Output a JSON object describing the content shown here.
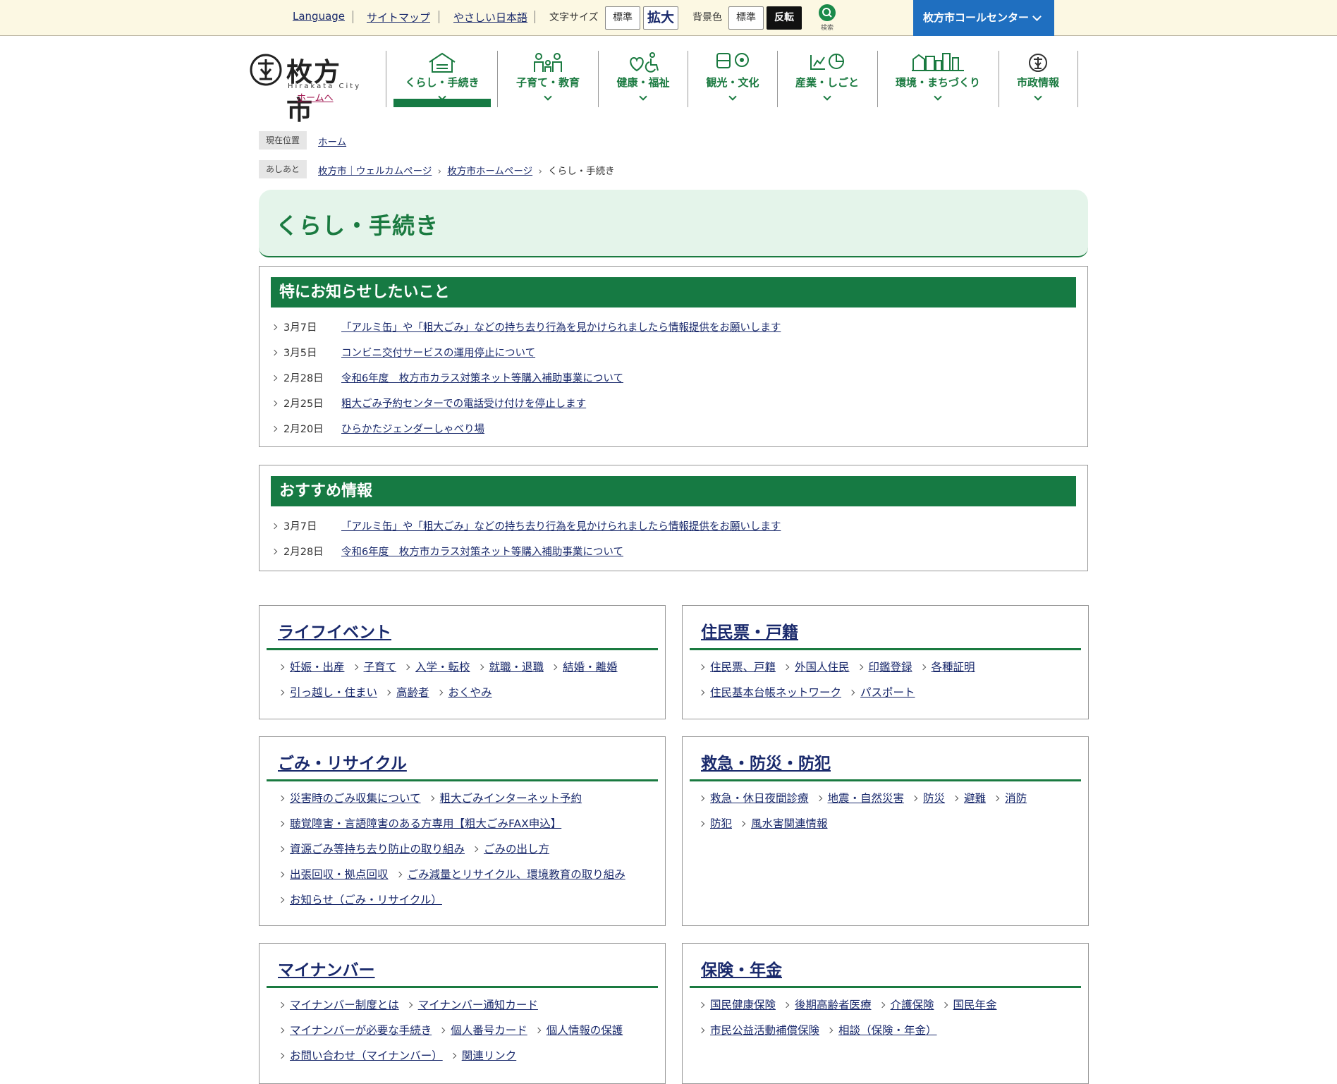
{
  "topbar": {
    "language": "Language",
    "sitemap": "サイトマップ",
    "easy_japanese": "やさしい日本語",
    "font_size_label": "文字サイズ",
    "font_standard": "標準",
    "font_large": "拡大",
    "bg_label": "背景色",
    "bg_standard": "標準",
    "bg_invert": "反転",
    "search_label": "検索",
    "call_center": "枚方市コールセンター"
  },
  "logo": {
    "name": "枚方市",
    "romaji": "Hirakata City",
    "home_link": "ホームへ"
  },
  "nav": [
    {
      "label": "くらし・手続き",
      "icon": "house-icon",
      "active": true
    },
    {
      "label": "子育て・教育",
      "icon": "family-icon"
    },
    {
      "label": "健康・福祉",
      "icon": "health-wheelchair-icon"
    },
    {
      "label": "観光・文化",
      "icon": "bus-flower-icon"
    },
    {
      "label": "産業・しごと",
      "icon": "chart-icon"
    },
    {
      "label": "環境・まちづくり",
      "icon": "city-icon"
    },
    {
      "label": "市政情報",
      "icon": "city-emblem-icon"
    }
  ],
  "breadcrumb": {
    "current_badge": "現在位置",
    "home": "ホーム",
    "trail_badge": "あしあと",
    "trail": [
      "枚方市｜ウェルカムページ",
      "枚方市ホームページ",
      "くらし・手続き"
    ]
  },
  "page_title": "くらし・手続き",
  "notices": {
    "title": "特にお知らせしたいこと",
    "items": [
      {
        "date": "3月7日",
        "text": "「アルミ缶」や「粗大ごみ」などの持ち去り行為を見かけられましたら情報提供をお願いします"
      },
      {
        "date": "3月5日",
        "text": "コンビニ交付サービスの運用停止について"
      },
      {
        "date": "2月28日",
        "text": "令和6年度　枚方市カラス対策ネット等購入補助事業について"
      },
      {
        "date": "2月25日",
        "text": "粗大ごみ予約センターでの電話受け付けを停止します"
      },
      {
        "date": "2月20日",
        "text": "ひらかたジェンダーしゃべり場"
      }
    ]
  },
  "recommended": {
    "title": "おすすめ情報",
    "items": [
      {
        "date": "3月7日",
        "text": "「アルミ缶」や「粗大ごみ」などの持ち去り行為を見かけられましたら情報提供をお願いします"
      },
      {
        "date": "2月28日",
        "text": "令和6年度　枚方市カラス対策ネット等購入補助事業について"
      }
    ]
  },
  "categories": [
    {
      "title": "ライフイベント",
      "rows": [
        [
          "妊娠・出産",
          "子育て",
          "入学・転校",
          "就職・退職",
          "結婚・離婚"
        ],
        [
          "引っ越し・住まい",
          "高齢者",
          "おくやみ"
        ]
      ]
    },
    {
      "title": "住民票・戸籍",
      "rows": [
        [
          "住民票、戸籍",
          "外国人住民",
          "印鑑登録",
          "各種証明"
        ],
        [
          "住民基本台帳ネットワーク",
          "パスポート"
        ]
      ]
    },
    {
      "title": "ごみ・リサイクル",
      "rows": [
        [
          "災害時のごみ収集について",
          "粗大ごみインターネット予約"
        ],
        [
          "聴覚障害・言語障害のある方専用【粗大ごみFAX申込】"
        ],
        [
          "資源ごみ等持ち去り防止の取り組み",
          "ごみの出し方"
        ],
        [
          "出張回収・拠点回収",
          "ごみ減量とリサイクル、環境教育の取り組み"
        ],
        [
          "お知らせ（ごみ・リサイクル）"
        ]
      ]
    },
    {
      "title": "救急・防災・防犯",
      "rows": [
        [
          "救急・休日夜間診療",
          "地震・自然災害",
          "防災",
          "避難",
          "消防"
        ],
        [
          "防犯",
          "風水害関連情報"
        ]
      ]
    },
    {
      "title": "マイナンバー",
      "rows": [
        [
          "マイナンバー制度とは",
          "マイナンバー通知カード"
        ],
        [
          "マイナンバーが必要な手続き",
          "個人番号カード",
          "個人情報の保護"
        ],
        [
          "お問い合わせ（マイナンバー）",
          "関連リンク"
        ]
      ]
    },
    {
      "title": "保険・年金",
      "rows": [
        [
          "国民健康保険",
          "後期高齢者医療",
          "介護保険",
          "国民年金"
        ],
        [
          "市民公益活動補償保険",
          "相談（保険・年金）"
        ]
      ]
    }
  ],
  "colors": {
    "accent_green": "#167a43",
    "call_center_blue": "#1f6fc0",
    "topbar_bg": "#fcf8e3",
    "title_bg": "#e4f4ea",
    "link": "#1a2a6c"
  }
}
